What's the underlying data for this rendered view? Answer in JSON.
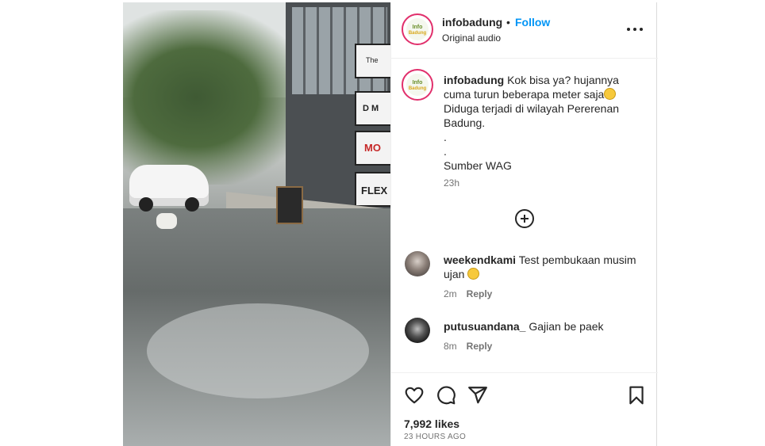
{
  "post": {
    "username": "infobadung",
    "separator": "•",
    "follow_label": "Follow",
    "audio": "Original audio",
    "avatar_text_top": "Info",
    "avatar_text_bottom": "Badung"
  },
  "caption": {
    "username": "infobadung",
    "line1": " Kok bisa ya? hujannya cuma turun beberapa meter saja",
    "line2": "Diduga terjadi di wilayah Pererenan Badung.",
    "line3": ".",
    "line4": ".",
    "line5": "Sumber WAG",
    "time": "23h",
    "emoji_name": "face-emoji"
  },
  "comments": [
    {
      "username": "weekendkami",
      "text": "Test pembukaan musim ujan",
      "time": "2m",
      "reply": "Reply",
      "emoji_name": "laughing-emoji"
    },
    {
      "username": "putusuandana_",
      "text": "Gajian be paek",
      "time": "8m",
      "reply": "Reply"
    }
  ],
  "footer": {
    "likes": "7,992 likes",
    "posted": "23 HOURS AGO"
  },
  "media": {
    "signs": [
      "The",
      "D M",
      "MO",
      "FLEX"
    ]
  },
  "colors": {
    "link": "#0095f6",
    "text": "#262626",
    "secondary": "#737373"
  }
}
